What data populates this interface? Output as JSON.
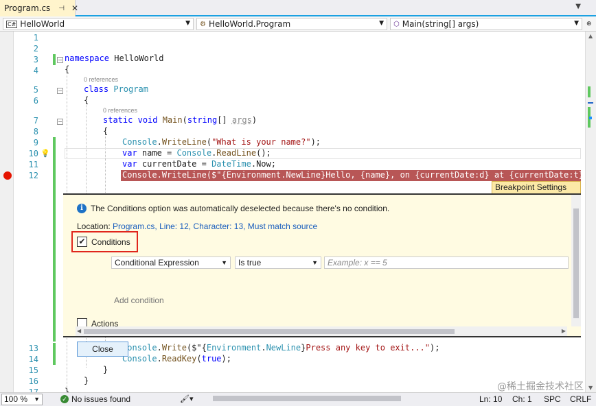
{
  "tab": {
    "title": "Program.cs",
    "pin_glyph": "⊣",
    "close_glyph": "✕"
  },
  "navbar": {
    "project": "HelloWorld",
    "class": "HelloWorld.Program",
    "member": "Main(string[] args)",
    "project_icon": "C#"
  },
  "editor": {
    "line_numbers": [
      "1",
      "2",
      "3",
      "4",
      "5",
      "6",
      "7",
      "8",
      "9",
      "10",
      "11",
      "12",
      "13",
      "14",
      "15",
      "16",
      "17"
    ],
    "codelens_refs": "0 references",
    "code": {
      "l3_kw": "namespace",
      "l3_name": " HelloWorld",
      "l4": "{",
      "l5_kw": "class",
      "l5_name": " Program",
      "l6": "{",
      "l7_kw1": "static",
      "l7_kw2": "void",
      "l7_name": "Main",
      "l7_p1": "(",
      "l7_kw3": "string",
      "l7_p2": "[] ",
      "l7_arg": "args",
      "l7_p3": ")",
      "l8": "{",
      "l9_a": "Console",
      "l9_b": ".",
      "l9_c": "WriteLine",
      "l9_d": "(",
      "l9_str": "\"What is your name?\"",
      "l9_e": ");",
      "l10_kw": "var",
      "l10_a": " name = ",
      "l10_b": "Console",
      "l10_c": ".",
      "l10_d": "ReadLine",
      "l10_e": "();",
      "l11_kw": "var",
      "l11_a": " currentDate = ",
      "l11_b": "DateTime",
      "l11_c": ".Now;",
      "l12": "Console.WriteLine($\"{Environment.NewLine}Hello, {name}, on {currentDate:d} at {currentDate:t}!\");",
      "l13_a": "Console",
      "l13_b": ".",
      "l13_c": "Write",
      "l13_d": "($\"{",
      "l13_e": "Environment",
      "l13_f": ".",
      "l13_g": "NewLine",
      "l13_h": "}",
      "l13_str": "Press any key to exit...\"",
      "l13_i": ");",
      "l14_a": "Console",
      "l14_b": ".",
      "l14_c": "ReadKey",
      "l14_d": "(",
      "l14_kw": "true",
      "l14_e": ");",
      "l15": "}",
      "l16": "}",
      "l17": "}"
    }
  },
  "breakpoint_settings": {
    "tab_label": "Breakpoint Settings",
    "info_message": "The Conditions option was automatically deselected because there's no condition.",
    "location_label": "Location: ",
    "location_value": "Program.cs, Line: 12, Character: 13, Must match source",
    "conditions_label": "Conditions",
    "conditions_checked": "✔",
    "condition_type": "Conditional Expression",
    "condition_op": "Is true",
    "expression_placeholder": "Example: x == 5",
    "add_condition": "Add condition",
    "actions_label": "Actions",
    "close_button": "Close"
  },
  "statusbar": {
    "zoom": "100 %",
    "issues": "No issues found",
    "line": "Ln: 10",
    "col": "Ch: 1",
    "mode": "SPC",
    "eol": "CRLF"
  },
  "watermark": "@稀土掘金技术社区",
  "colors": {
    "breakpoint": "#e51400",
    "highlight": "#b85656",
    "peek_background": "#fffbe2",
    "change_bar": "#5fc85f",
    "accent": "#1ba1e2"
  }
}
